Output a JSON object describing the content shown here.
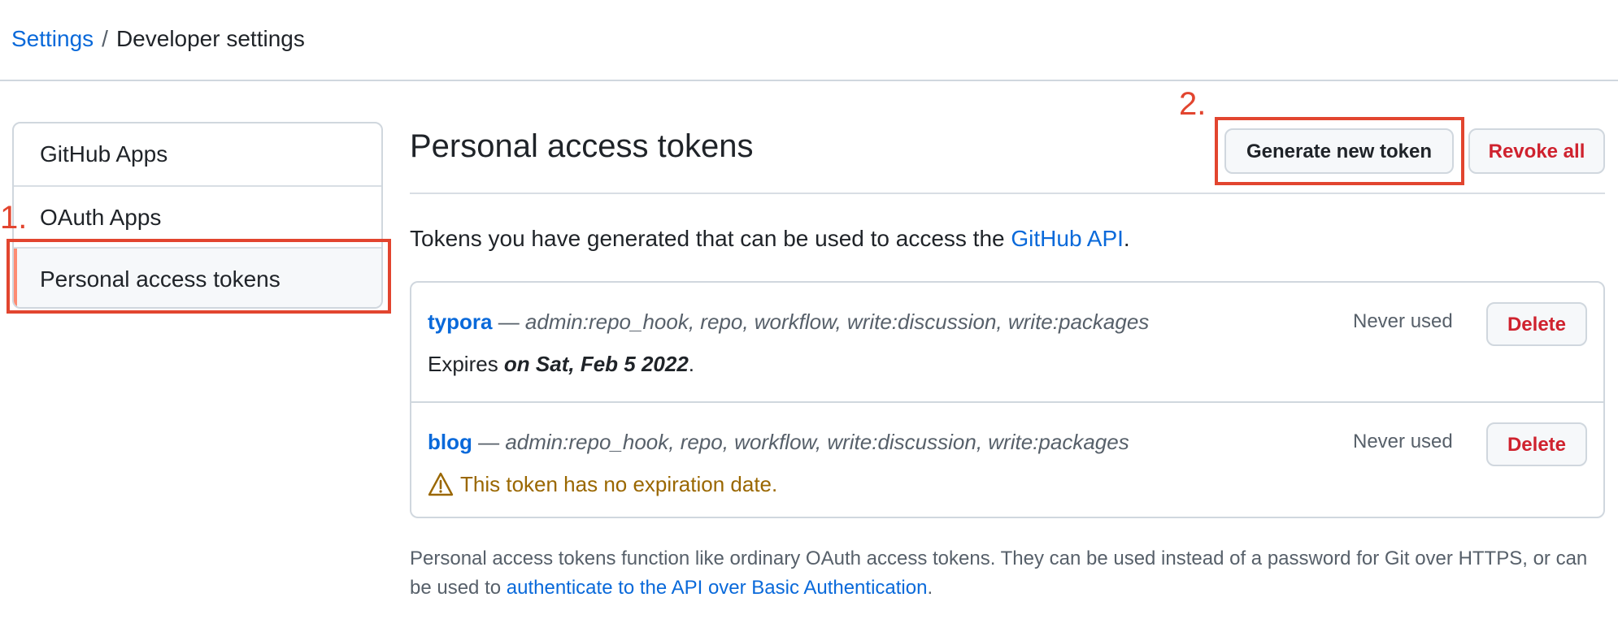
{
  "breadcrumb": {
    "settings": "Settings",
    "separator": "/",
    "current": "Developer settings"
  },
  "sidebar": {
    "items": [
      {
        "label": "GitHub Apps"
      },
      {
        "label": "OAuth Apps"
      },
      {
        "label": "Personal access tokens",
        "selected": true
      }
    ]
  },
  "annotations": {
    "step1": "1.",
    "step2": "2."
  },
  "main": {
    "title": "Personal access tokens",
    "generate_label": "Generate new token",
    "revoke_label": "Revoke all",
    "intro_text": "Tokens you have generated that can be used to access the ",
    "intro_link": "GitHub API",
    "intro_end": "."
  },
  "tokens": [
    {
      "name": "typora",
      "dash": " — ",
      "scopes": "admin:repo_hook, repo, workflow, write:discussion, write:packages",
      "expires_prefix": "Expires ",
      "expires_date": "on Sat, Feb 5 2022",
      "expires_suffix": ".",
      "last_used": "Never used",
      "delete_label": "Delete"
    },
    {
      "name": "blog",
      "dash": " — ",
      "scopes": "admin:repo_hook, repo, workflow, write:discussion, write:packages",
      "warning": "This token has no expiration date.",
      "warning_icon": "alert-icon",
      "last_used": "Never used",
      "delete_label": "Delete"
    }
  ],
  "footnote": {
    "text": "Personal access tokens function like ordinary OAuth access tokens. They can be used instead of a password for Git over HTTPS, or can be used to ",
    "link": "authenticate to the API over Basic Authentication",
    "end": "."
  },
  "colors": {
    "link": "#0969da",
    "danger": "#cf222e",
    "annotation": "#e2452f",
    "warning": "#9a6700",
    "selected_accent": "#fd8c73"
  }
}
